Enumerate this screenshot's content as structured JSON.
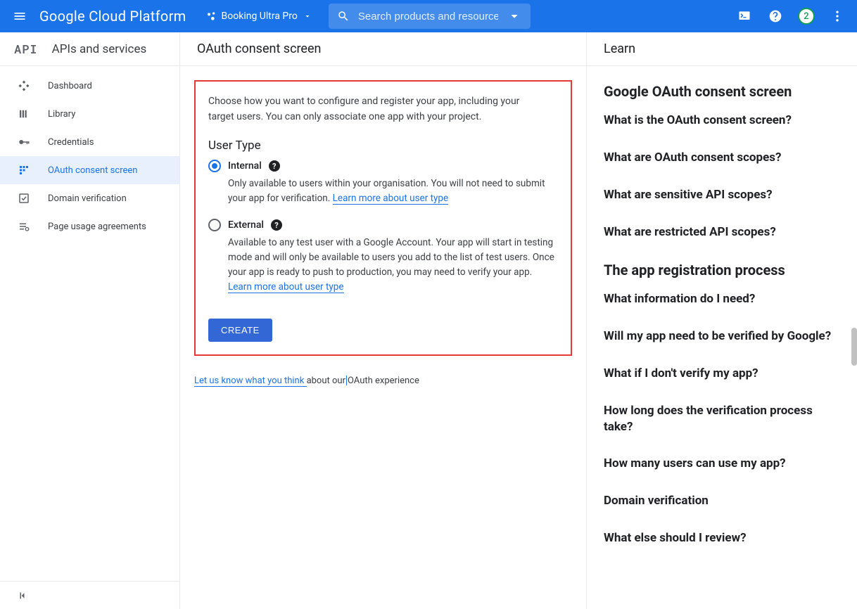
{
  "header": {
    "logo": "Google Cloud Platform",
    "project": "Booking Ultra Pro",
    "search_placeholder": "Search products and resources",
    "badge_count": "2"
  },
  "sidebar": {
    "title": "APIs and services",
    "items": [
      {
        "label": "Dashboard"
      },
      {
        "label": "Library"
      },
      {
        "label": "Credentials"
      },
      {
        "label": "OAuth consent screen"
      },
      {
        "label": "Domain verification"
      },
      {
        "label": "Page usage agreements"
      }
    ]
  },
  "center": {
    "title": "OAuth consent screen",
    "intro": "Choose how you want to configure and register your app, including your target users. You can only associate one app with your project.",
    "user_type_heading": "User Type",
    "internal": {
      "label": "Internal",
      "desc": "Only available to users within your organisation. You will not need to submit your app for verification. ",
      "link": "Learn more about user type"
    },
    "external": {
      "label": "External",
      "desc": "Available to any test user with a Google Account. Your app will start in testing mode and will only be available to users you add to the list of test users. Once your app is ready to push to production, you may need to verify your app. ",
      "link": "Learn more about user type"
    },
    "create_label": "CREATE",
    "feedback_link": "Let us know what you think ",
    "feedback_rest_a": "about our",
    "feedback_rest_b": "OAuth experience"
  },
  "right": {
    "header": "Learn",
    "sections": [
      {
        "title": "Google OAuth consent screen",
        "links": [
          "What is the OAuth consent screen?",
          "What are OAuth consent scopes?",
          "What are sensitive API scopes?",
          "What are restricted API scopes?"
        ]
      },
      {
        "title": "The app registration process",
        "links": [
          "What information do I need?",
          "Will my app need to be verified by Google?",
          "What if I don't verify my app?",
          "How long does the verification process take?",
          "How many users can use my app?",
          "Domain verification",
          "What else should I review?"
        ]
      }
    ]
  }
}
